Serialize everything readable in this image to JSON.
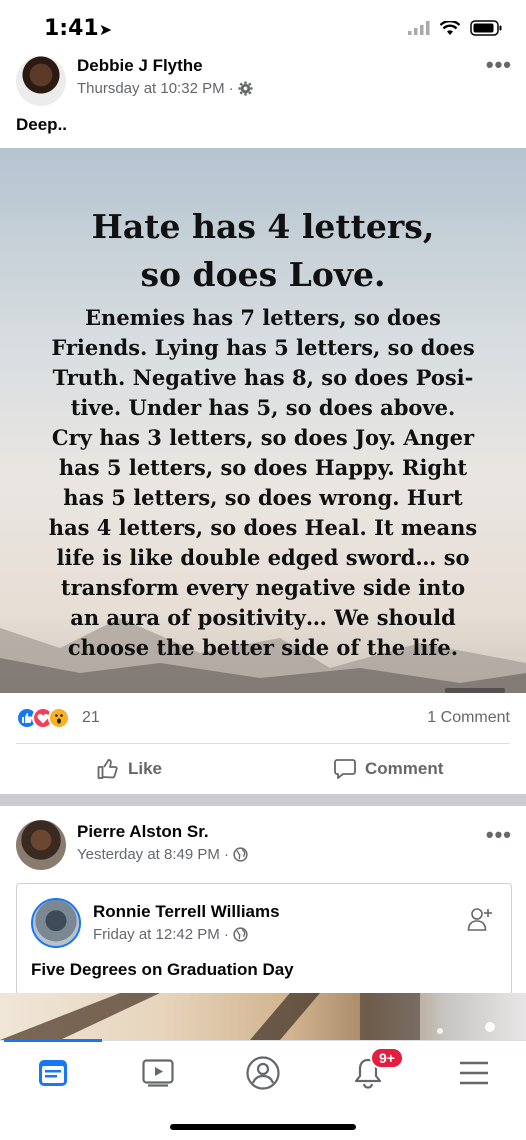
{
  "status_bar": {
    "time": "1:41"
  },
  "post1": {
    "author": "Debbie J Flythe",
    "meta": "Thursday at 10:32 PM ·",
    "text": "Deep..",
    "image_quote": {
      "headline_1": "Hate has 4 letters,",
      "headline_2": "so does Love.",
      "body_lines": [
        "Enemies has 7 letters, so does",
        "Friends. Lying has 5 letters, so does",
        "Truth. Negative has 8, so does Posi-",
        "tive. Under has 5, so does above.",
        "Cry has 3 letters, so does Joy. Anger",
        "has 5 letters, so does Happy. Right",
        "has 5 letters, so does wrong. Hurt",
        "has 4 letters, so does Heal. It means",
        "life is like double edged sword… so",
        "transform every negative side into",
        "an aura of positivity… We should",
        "choose the better side of the life."
      ]
    },
    "reactions": {
      "count": "21",
      "types": [
        "like-icon",
        "love-icon",
        "wow-icon"
      ]
    },
    "comments_label": "1 Comment",
    "actions": {
      "like": "Like",
      "comment": "Comment"
    }
  },
  "post2": {
    "author": "Pierre Alston Sr.",
    "meta": "Yesterday at 8:49 PM ·",
    "shared": {
      "author": "Ronnie Terrell Williams",
      "meta": "Friday at 12:42 PM ·",
      "caption": "Five Degrees on Graduation Day"
    }
  },
  "bottom_nav": {
    "items": [
      "news-feed-icon",
      "watch-icon",
      "profile-icon",
      "notifications-icon",
      "menu-icon"
    ],
    "notifications_badge": "9+"
  },
  "colors": {
    "accent": "#1877f2",
    "badge": "#e41e3f",
    "secondary_text": "#65676b"
  }
}
